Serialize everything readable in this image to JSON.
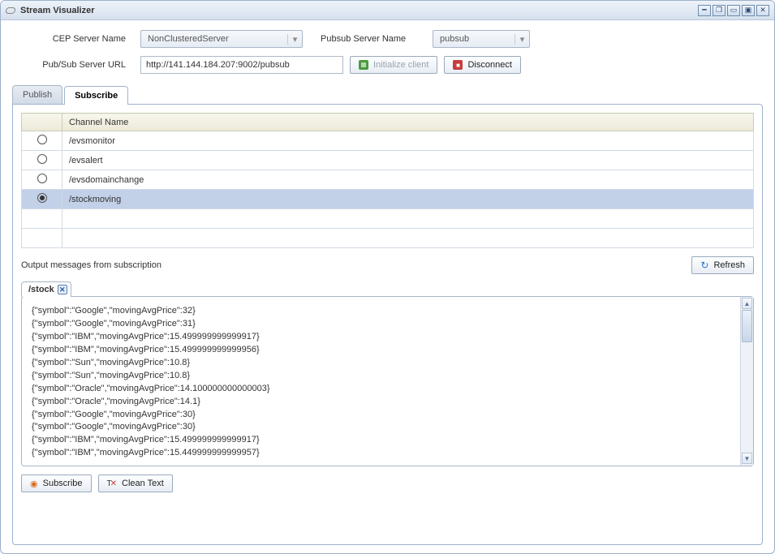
{
  "window": {
    "title": "Stream Visualizer"
  },
  "form": {
    "cep_label": "CEP Server Name",
    "cep_value": "NonClusteredServer",
    "pubsub_name_label": "Pubsub Server Name",
    "pubsub_name_value": "pubsub",
    "url_label": "Pub/Sub Server URL",
    "url_value": "http://141.144.184.207:9002/pubsub",
    "init_label": "Initialize client",
    "disconnect_label": "Disconnect"
  },
  "tabs": {
    "publish": "Publish",
    "subscribe": "Subscribe"
  },
  "grid": {
    "col_radio": "",
    "col_name": "Channel Name",
    "rows": [
      {
        "name": "/evsmonitor",
        "selected": false
      },
      {
        "name": "/evsalert",
        "selected": false
      },
      {
        "name": "/evsdomainchange",
        "selected": false
      },
      {
        "name": "/stockmoving",
        "selected": true
      }
    ]
  },
  "output": {
    "label": "Output messages from subscription",
    "refresh": "Refresh",
    "tab_label": "/stock",
    "messages": [
      "{\"symbol\":\"Google\",\"movingAvgPrice\":32}",
      "{\"symbol\":\"Google\",\"movingAvgPrice\":31}",
      "{\"symbol\":\"IBM\",\"movingAvgPrice\":15.499999999999917}",
      "{\"symbol\":\"IBM\",\"movingAvgPrice\":15.499999999999956}",
      "{\"symbol\":\"Sun\",\"movingAvgPrice\":10.8}",
      "{\"symbol\":\"Sun\",\"movingAvgPrice\":10.8}",
      "{\"symbol\":\"Oracle\",\"movingAvgPrice\":14.100000000000003}",
      "{\"symbol\":\"Oracle\",\"movingAvgPrice\":14.1}",
      "{\"symbol\":\"Google\",\"movingAvgPrice\":30}",
      "{\"symbol\":\"Google\",\"movingAvgPrice\":30}",
      "{\"symbol\":\"IBM\",\"movingAvgPrice\":15.499999999999917}",
      "{\"symbol\":\"IBM\",\"movingAvgPrice\":15.449999999999957}"
    ]
  },
  "buttons": {
    "subscribe": "Subscribe",
    "clean": "Clean Text"
  }
}
